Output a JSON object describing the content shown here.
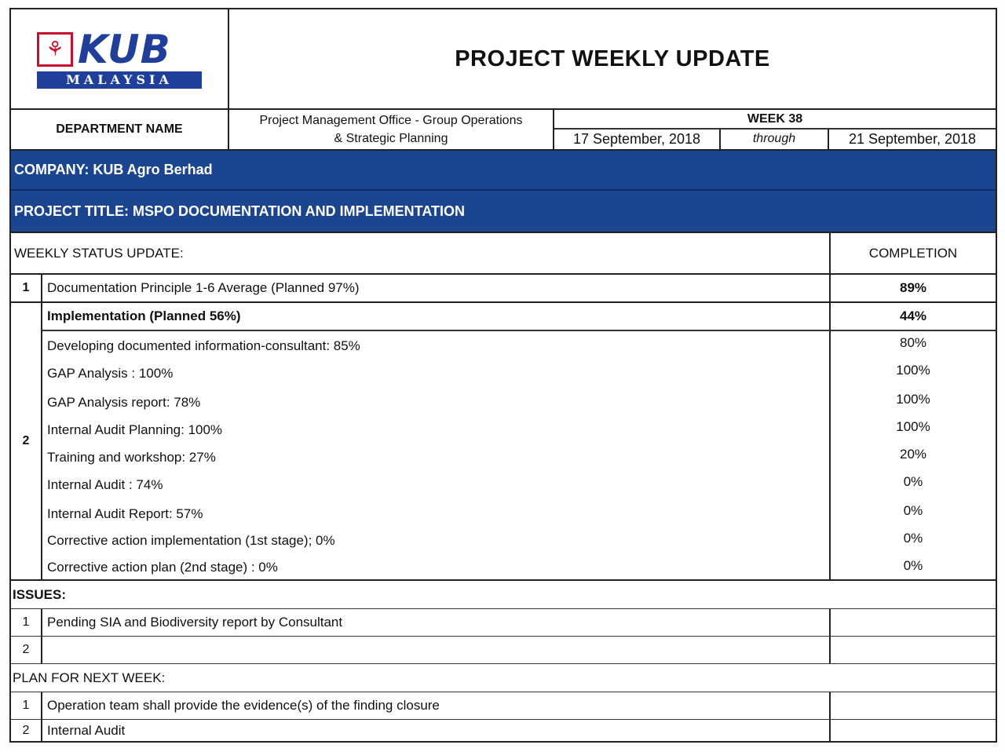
{
  "logo": {
    "brand": "KUB",
    "country": "MALAYSIA"
  },
  "header": {
    "title": "PROJECT WEEKLY UPDATE"
  },
  "department": {
    "label": "DEPARTMENT NAME",
    "value_line1": "Project Management Office - Group Operations",
    "value_line2": "& Strategic Planning"
  },
  "week": {
    "label": "WEEK 38",
    "start": "17 September, 2018",
    "through": "through",
    "end": "21 September, 2018"
  },
  "company": "COMPANY: KUB Agro Berhad",
  "project_title": "PROJECT TITLE: MSPO DOCUMENTATION AND IMPLEMENTATION",
  "status": {
    "label": "WEEKLY STATUS UPDATE:",
    "completion_header": "COMPLETION",
    "item1": {
      "no": "1",
      "text": "Documentation Principle 1-6 Average (Planned 97%)",
      "completion": "89%"
    },
    "item2": {
      "no": "2",
      "text": "Implementation (Planned 56%)",
      "completion": "44%",
      "subitems": [
        {
          "text": "Developing documented information-consultant: 85%",
          "completion": "80%"
        },
        {
          "text": "GAP Analysis : 100%",
          "completion": "100%"
        },
        {
          "text": "GAP Analysis report: 78%",
          "completion": "100%"
        },
        {
          "text": "Internal Audit Planning: 100%",
          "completion": "100%"
        },
        {
          "text": "Training and workshop:  27%",
          "completion": "20%"
        },
        {
          "text": "Internal Audit : 74%",
          "completion": "0%"
        },
        {
          "text": "Internal Audit Report: 57%",
          "completion": "0%"
        },
        {
          "text": "Corrective action implementation (1st stage); 0%",
          "completion": "0%"
        },
        {
          "text": "Corrective action plan (2nd stage) : 0%",
          "completion": "0%"
        }
      ]
    }
  },
  "issues": {
    "label": "ISSUES:",
    "items": [
      {
        "no": "1",
        "text": "Pending SIA and Biodiversity  report by Consultant"
      },
      {
        "no": "2",
        "text": ""
      }
    ]
  },
  "plan": {
    "label": "PLAN FOR NEXT WEEK:",
    "items": [
      {
        "no": "1",
        "text": "Operation team shall provide the evidence(s) of the finding closure"
      },
      {
        "no": "2",
        "text": "Internal Audit"
      }
    ]
  },
  "colors": {
    "band": "#1c4590",
    "logo_blue": "#1f3f9a",
    "logo_red": "#c8102e"
  }
}
